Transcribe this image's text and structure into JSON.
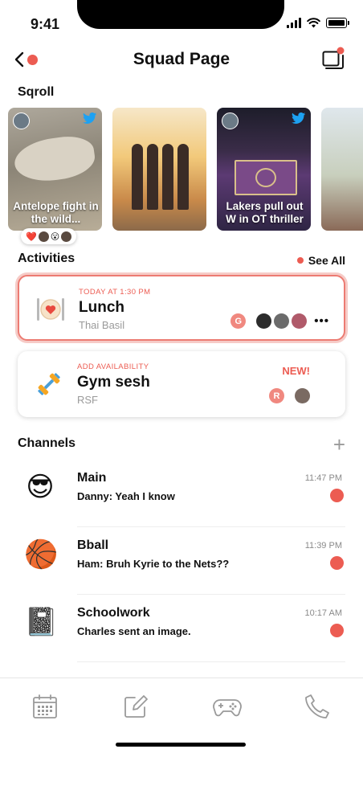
{
  "status_bar": {
    "time": "9:41"
  },
  "header": {
    "title": "Squad Page"
  },
  "sqroll": {
    "title": "Sqroll",
    "cards": [
      {
        "caption": "Antelope fight in the wild...",
        "source_icon": "twitter-icon"
      },
      {
        "caption": ""
      },
      {
        "caption": "Lakers pull out W in OT thriller",
        "source_icon": "twitter-icon"
      },
      {
        "caption": ""
      }
    ],
    "reactions": {
      "emoji": "❤️",
      "emoji2": "😮"
    }
  },
  "activities": {
    "title": "Activities",
    "see_all": "See All",
    "items": [
      {
        "eyebrow": "TODAY AT 1:30 PM",
        "title": "Lunch",
        "location": "Thai Basil",
        "initial": "G"
      },
      {
        "eyebrow": "ADD AVAILABILITY",
        "title": "Gym sesh",
        "location": "RSF",
        "initial": "R",
        "badge": "NEW!"
      }
    ]
  },
  "channels": {
    "title": "Channels",
    "add": "+",
    "items": [
      {
        "emoji": "😎",
        "name": "Main",
        "last_message": "Danny: Yeah I know",
        "time": "11:47 PM",
        "unread": true
      },
      {
        "emoji": "🏀",
        "name": "Bball",
        "last_message": "Ham: Bruh Kyrie to the Nets??",
        "time": "11:39 PM",
        "unread": true
      },
      {
        "emoji": "📓",
        "name": "Schoolwork",
        "last_message": "Charles sent an image.",
        "time": "10:17 AM",
        "unread": true
      }
    ]
  },
  "tab_bar": {
    "items": [
      "calendar-icon",
      "compose-icon",
      "gamepad-icon",
      "phone-icon"
    ]
  },
  "colors": {
    "accent": "#ec5c52",
    "accent_light": "#f6cbc7",
    "muted": "#9a9a9a"
  }
}
